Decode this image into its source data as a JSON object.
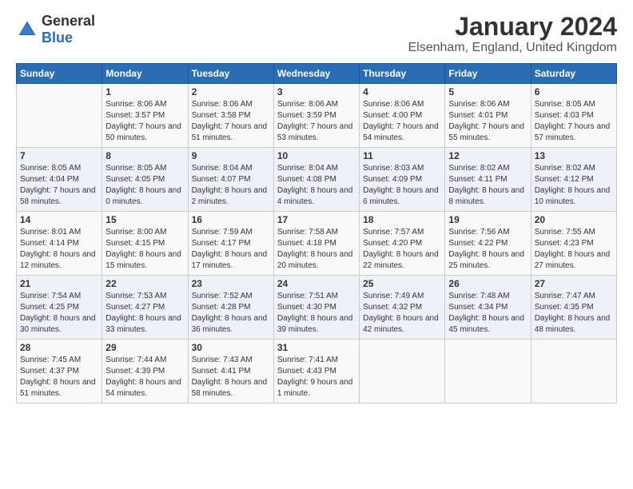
{
  "header": {
    "logo_general": "General",
    "logo_blue": "Blue",
    "month_title": "January 2024",
    "location": "Elsenham, England, United Kingdom"
  },
  "days_of_week": [
    "Sunday",
    "Monday",
    "Tuesday",
    "Wednesday",
    "Thursday",
    "Friday",
    "Saturday"
  ],
  "weeks": [
    [
      {
        "day": "",
        "sunrise": "",
        "sunset": "",
        "daylight": ""
      },
      {
        "day": "1",
        "sunrise": "Sunrise: 8:06 AM",
        "sunset": "Sunset: 3:57 PM",
        "daylight": "Daylight: 7 hours and 50 minutes."
      },
      {
        "day": "2",
        "sunrise": "Sunrise: 8:06 AM",
        "sunset": "Sunset: 3:58 PM",
        "daylight": "Daylight: 7 hours and 51 minutes."
      },
      {
        "day": "3",
        "sunrise": "Sunrise: 8:06 AM",
        "sunset": "Sunset: 3:59 PM",
        "daylight": "Daylight: 7 hours and 53 minutes."
      },
      {
        "day": "4",
        "sunrise": "Sunrise: 8:06 AM",
        "sunset": "Sunset: 4:00 PM",
        "daylight": "Daylight: 7 hours and 54 minutes."
      },
      {
        "day": "5",
        "sunrise": "Sunrise: 8:06 AM",
        "sunset": "Sunset: 4:01 PM",
        "daylight": "Daylight: 7 hours and 55 minutes."
      },
      {
        "day": "6",
        "sunrise": "Sunrise: 8:05 AM",
        "sunset": "Sunset: 4:03 PM",
        "daylight": "Daylight: 7 hours and 57 minutes."
      }
    ],
    [
      {
        "day": "7",
        "sunrise": "Sunrise: 8:05 AM",
        "sunset": "Sunset: 4:04 PM",
        "daylight": "Daylight: 7 hours and 58 minutes."
      },
      {
        "day": "8",
        "sunrise": "Sunrise: 8:05 AM",
        "sunset": "Sunset: 4:05 PM",
        "daylight": "Daylight: 8 hours and 0 minutes."
      },
      {
        "day": "9",
        "sunrise": "Sunrise: 8:04 AM",
        "sunset": "Sunset: 4:07 PM",
        "daylight": "Daylight: 8 hours and 2 minutes."
      },
      {
        "day": "10",
        "sunrise": "Sunrise: 8:04 AM",
        "sunset": "Sunset: 4:08 PM",
        "daylight": "Daylight: 8 hours and 4 minutes."
      },
      {
        "day": "11",
        "sunrise": "Sunrise: 8:03 AM",
        "sunset": "Sunset: 4:09 PM",
        "daylight": "Daylight: 8 hours and 6 minutes."
      },
      {
        "day": "12",
        "sunrise": "Sunrise: 8:02 AM",
        "sunset": "Sunset: 4:11 PM",
        "daylight": "Daylight: 8 hours and 8 minutes."
      },
      {
        "day": "13",
        "sunrise": "Sunrise: 8:02 AM",
        "sunset": "Sunset: 4:12 PM",
        "daylight": "Daylight: 8 hours and 10 minutes."
      }
    ],
    [
      {
        "day": "14",
        "sunrise": "Sunrise: 8:01 AM",
        "sunset": "Sunset: 4:14 PM",
        "daylight": "Daylight: 8 hours and 12 minutes."
      },
      {
        "day": "15",
        "sunrise": "Sunrise: 8:00 AM",
        "sunset": "Sunset: 4:15 PM",
        "daylight": "Daylight: 8 hours and 15 minutes."
      },
      {
        "day": "16",
        "sunrise": "Sunrise: 7:59 AM",
        "sunset": "Sunset: 4:17 PM",
        "daylight": "Daylight: 8 hours and 17 minutes."
      },
      {
        "day": "17",
        "sunrise": "Sunrise: 7:58 AM",
        "sunset": "Sunset: 4:18 PM",
        "daylight": "Daylight: 8 hours and 20 minutes."
      },
      {
        "day": "18",
        "sunrise": "Sunrise: 7:57 AM",
        "sunset": "Sunset: 4:20 PM",
        "daylight": "Daylight: 8 hours and 22 minutes."
      },
      {
        "day": "19",
        "sunrise": "Sunrise: 7:56 AM",
        "sunset": "Sunset: 4:22 PM",
        "daylight": "Daylight: 8 hours and 25 minutes."
      },
      {
        "day": "20",
        "sunrise": "Sunrise: 7:55 AM",
        "sunset": "Sunset: 4:23 PM",
        "daylight": "Daylight: 8 hours and 27 minutes."
      }
    ],
    [
      {
        "day": "21",
        "sunrise": "Sunrise: 7:54 AM",
        "sunset": "Sunset: 4:25 PM",
        "daylight": "Daylight: 8 hours and 30 minutes."
      },
      {
        "day": "22",
        "sunrise": "Sunrise: 7:53 AM",
        "sunset": "Sunset: 4:27 PM",
        "daylight": "Daylight: 8 hours and 33 minutes."
      },
      {
        "day": "23",
        "sunrise": "Sunrise: 7:52 AM",
        "sunset": "Sunset: 4:28 PM",
        "daylight": "Daylight: 8 hours and 36 minutes."
      },
      {
        "day": "24",
        "sunrise": "Sunrise: 7:51 AM",
        "sunset": "Sunset: 4:30 PM",
        "daylight": "Daylight: 8 hours and 39 minutes."
      },
      {
        "day": "25",
        "sunrise": "Sunrise: 7:49 AM",
        "sunset": "Sunset: 4:32 PM",
        "daylight": "Daylight: 8 hours and 42 minutes."
      },
      {
        "day": "26",
        "sunrise": "Sunrise: 7:48 AM",
        "sunset": "Sunset: 4:34 PM",
        "daylight": "Daylight: 8 hours and 45 minutes."
      },
      {
        "day": "27",
        "sunrise": "Sunrise: 7:47 AM",
        "sunset": "Sunset: 4:35 PM",
        "daylight": "Daylight: 8 hours and 48 minutes."
      }
    ],
    [
      {
        "day": "28",
        "sunrise": "Sunrise: 7:45 AM",
        "sunset": "Sunset: 4:37 PM",
        "daylight": "Daylight: 8 hours and 51 minutes."
      },
      {
        "day": "29",
        "sunrise": "Sunrise: 7:44 AM",
        "sunset": "Sunset: 4:39 PM",
        "daylight": "Daylight: 8 hours and 54 minutes."
      },
      {
        "day": "30",
        "sunrise": "Sunrise: 7:43 AM",
        "sunset": "Sunset: 4:41 PM",
        "daylight": "Daylight: 8 hours and 58 minutes."
      },
      {
        "day": "31",
        "sunrise": "Sunrise: 7:41 AM",
        "sunset": "Sunset: 4:43 PM",
        "daylight": "Daylight: 9 hours and 1 minute."
      },
      {
        "day": "",
        "sunrise": "",
        "sunset": "",
        "daylight": ""
      },
      {
        "day": "",
        "sunrise": "",
        "sunset": "",
        "daylight": ""
      },
      {
        "day": "",
        "sunrise": "",
        "sunset": "",
        "daylight": ""
      }
    ]
  ]
}
